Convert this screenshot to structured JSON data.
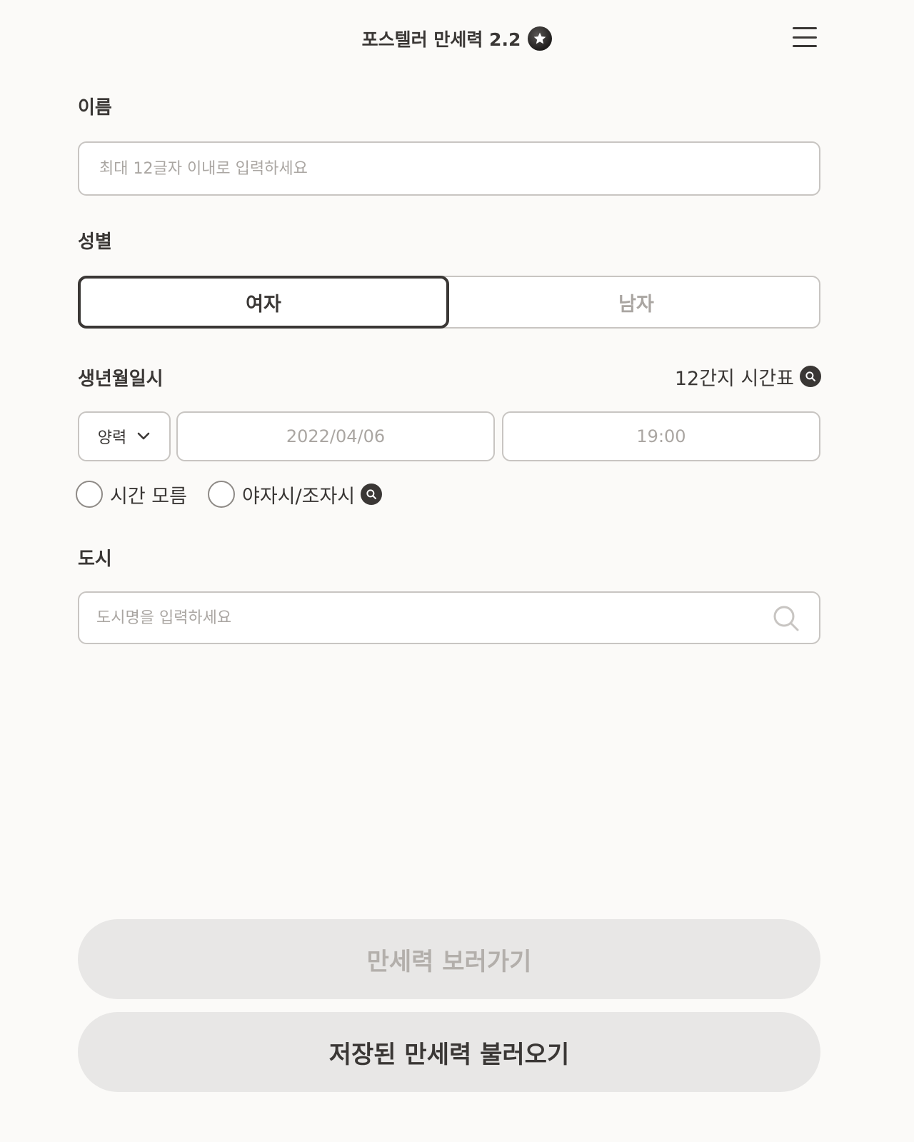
{
  "header": {
    "title": "포스텔러 만세력 2.2",
    "badge_icon": "star-badge-icon",
    "menu_icon": "hamburger-menu-icon"
  },
  "name_section": {
    "label": "이름",
    "placeholder": "최대 12글자 이내로 입력하세요",
    "value": ""
  },
  "gender_section": {
    "label": "성별",
    "options": [
      "여자",
      "남자"
    ],
    "selected": "여자"
  },
  "birth_section": {
    "label": "생년월일시",
    "timetable_link": "12간지 시간표",
    "calendar_type": "양력",
    "date_placeholder": "2022/04/06",
    "time_placeholder": "19:00",
    "unknown_time_label": "시간 모름",
    "night_time_label": "야자시/조자시"
  },
  "city_section": {
    "label": "도시",
    "placeholder": "도시명을 입력하세요"
  },
  "actions": {
    "view_button": "만세력 보러가기",
    "load_button": "저장된 만세력 불러오기"
  },
  "colors": {
    "background": "#fbfaf8",
    "text": "#3a3735",
    "border": "#c8c5c2",
    "placeholder": "#aaa6a2",
    "button_bg": "#e8e7e6"
  }
}
